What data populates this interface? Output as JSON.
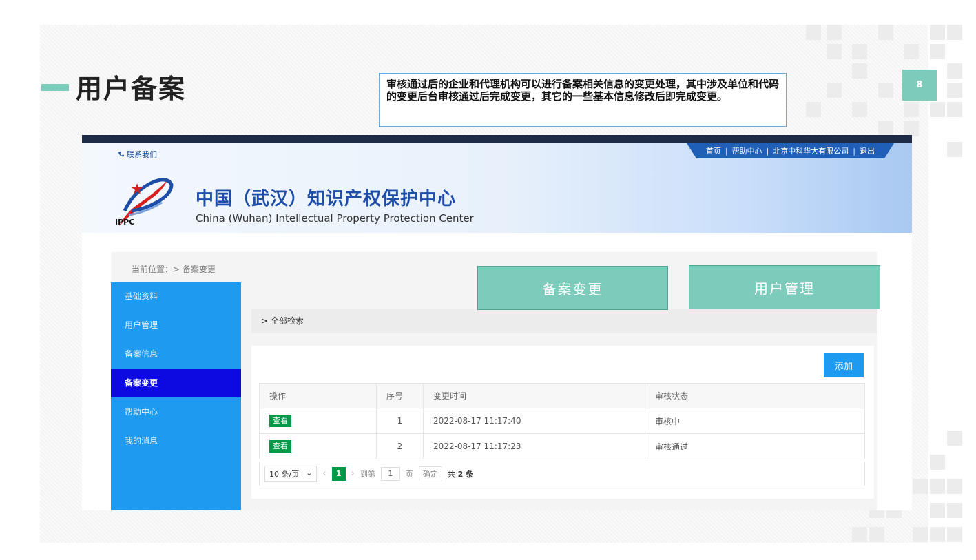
{
  "slide": {
    "title": "用户备案",
    "callout": "审核通过后的企业和代理机构可以进行备案相关信息的变更处理，其中涉及单位和代码的变更后台审核通过后完成变更，其它的一些基本信息修改后即完成变更。",
    "page_number": "8"
  },
  "colors": {
    "accent": "#7ccbbb",
    "nav_blue": "#1e9bf0",
    "active_nav": "#0c0ae0",
    "green": "#009a49",
    "header_blue": "#1f5fb8"
  },
  "site": {
    "contact": "联系我们",
    "top_links": [
      "首页",
      "帮助中心",
      "北京中科华大有限公司",
      "退出"
    ],
    "logo_text": "IPPC",
    "org_name_cn": "中国（武汉）知识产权保护中心",
    "org_name_en": "China (Wuhan) Intellectual Property Protection Center"
  },
  "breadcrumb": "当前位置：> 备案变更",
  "sidebar": {
    "items": [
      {
        "label": "基础资料",
        "active": false
      },
      {
        "label": "用户管理",
        "active": false
      },
      {
        "label": "备案信息",
        "active": false
      },
      {
        "label": "备案变更",
        "active": true
      },
      {
        "label": "帮助中心",
        "active": false
      },
      {
        "label": "我的消息",
        "active": false
      }
    ]
  },
  "filter": {
    "label": "全部检索"
  },
  "toolbar": {
    "add_label": "添加"
  },
  "table": {
    "columns": [
      "操作",
      "序号",
      "变更时间",
      "审核状态"
    ],
    "rows": [
      {
        "action": "查看",
        "index": "1",
        "time": "2022-08-17 11:17:40",
        "status": "审核中"
      },
      {
        "action": "查看",
        "index": "2",
        "time": "2022-08-17 11:17:23",
        "status": "审核通过"
      }
    ]
  },
  "pagination": {
    "page_size": "10 条/页",
    "current": "1",
    "goto_label": "到第",
    "goto_value": "1",
    "page_unit": "页",
    "confirm": "确定",
    "total": "共 2 条"
  },
  "overlay_buttons": [
    "备案变更",
    "用户管理"
  ]
}
